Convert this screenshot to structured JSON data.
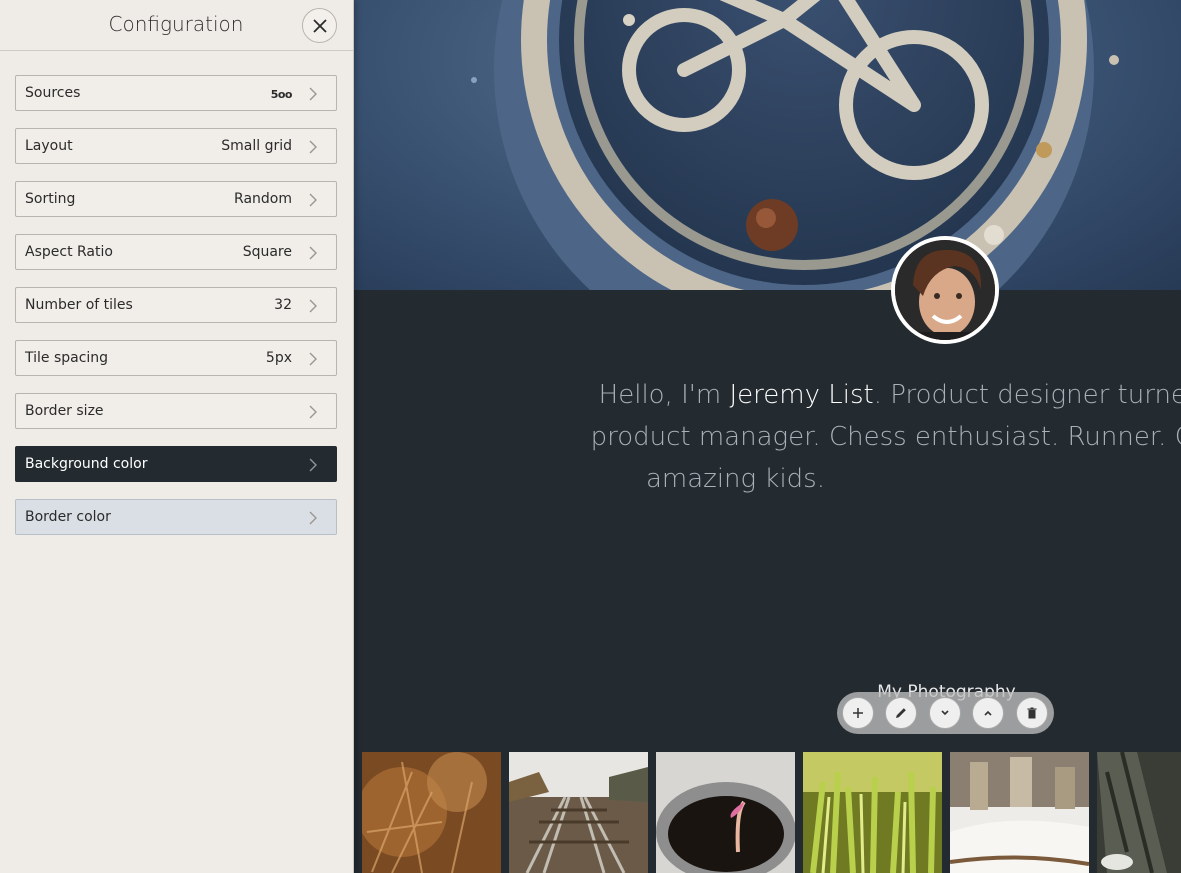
{
  "sidebar": {
    "title": "Configuration",
    "items": [
      {
        "label": "Sources",
        "value": "5oo"
      },
      {
        "label": "Layout",
        "value": "Small grid"
      },
      {
        "label": "Sorting",
        "value": "Random"
      },
      {
        "label": "Aspect Ratio",
        "value": "Square"
      },
      {
        "label": "Number of tiles",
        "value": "32"
      },
      {
        "label": "Tile spacing",
        "value": "5px"
      },
      {
        "label": "Border size",
        "value": ""
      },
      {
        "label": "Background color",
        "value": ""
      },
      {
        "label": "Border color",
        "value": ""
      }
    ]
  },
  "main": {
    "bio": {
      "prefix": "Hello, I'm ",
      "name": "Jeremy List",
      "line1_rest": ". Product designer turned UX de",
      "line2": "product manager. Chess enthusiast. Runner. Cyclist. C",
      "line3": "amazing kids."
    },
    "section_title": "My Photography",
    "toolbar_buttons": [
      "add-icon",
      "edit-icon",
      "chevron-down-icon",
      "chevron-up-icon",
      "trash-icon"
    ],
    "tiles": [
      "dried-grass-photo",
      "railroad-tracks-photo",
      "sprout-in-cup-photo",
      "green-sprouts-photo",
      "snowy-ruins-photo",
      "tree-bark-photo"
    ]
  },
  "colors": {
    "sidebar_bg": "#efebe7",
    "page_bg": "#232a30",
    "background_color_swatch": "#232a30",
    "border_color_swatch": "#d9dfe5"
  }
}
